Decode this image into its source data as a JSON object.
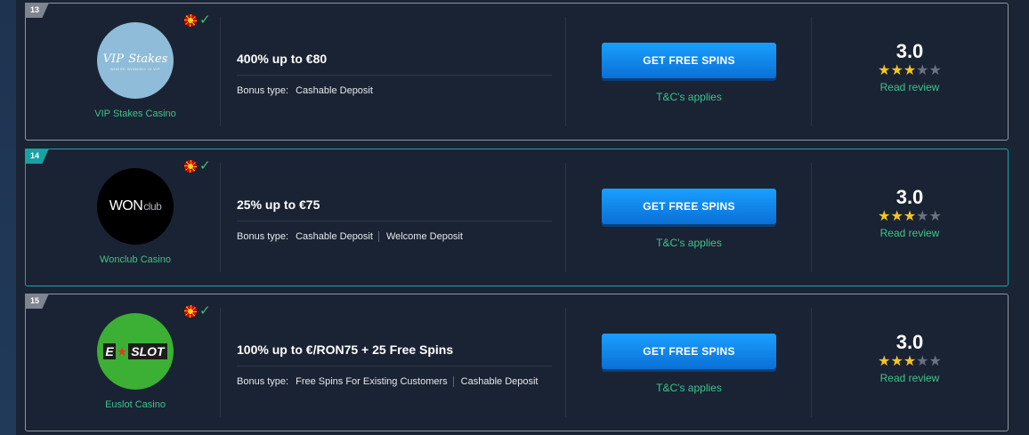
{
  "colors": {
    "accent_green": "#3ec38c",
    "button_blue": "#0a6fd6",
    "highlight_teal": "#1aa6a6",
    "star_yellow": "#f4c522"
  },
  "cards": [
    {
      "rank": "13",
      "casino_name": "VIP Stakes Casino",
      "logo": {
        "text_main": "VIP",
        "text_accent": "Stakes",
        "text_sub": "WHERE WINNING IS VIP"
      },
      "bonus_title": "400% up to €80",
      "bonus_type_label": "Bonus type:",
      "bonus_types": [
        "Cashable Deposit"
      ],
      "cta_label": "GET FREE SPINS",
      "tc_label": "T&C's applies",
      "score": "3.0",
      "stars_filled": 3,
      "read_review": "Read review",
      "icons": [
        "macedonia-flag-icon",
        "check-icon"
      ]
    },
    {
      "rank": "14",
      "casino_name": "Wonclub Casino",
      "logo": {
        "text_main": "WON",
        "text_accent": "club"
      },
      "bonus_title": "25% up to €75",
      "bonus_type_label": "Bonus type:",
      "bonus_types": [
        "Cashable Deposit",
        "Welcome Deposit"
      ],
      "cta_label": "GET FREE SPINS",
      "tc_label": "T&C's applies",
      "score": "3.0",
      "stars_filled": 3,
      "read_review": "Read review",
      "icons": [
        "macedonia-flag-icon",
        "check-icon"
      ]
    },
    {
      "rank": "15",
      "casino_name": "Euslot Casino",
      "logo": {
        "text_main": "E",
        "text_accent": "SLOT"
      },
      "bonus_title": "100% up to €/RON75 + 25 Free Spins",
      "bonus_type_label": "Bonus type:",
      "bonus_types": [
        "Free Spins For Existing Customers",
        "Cashable Deposit"
      ],
      "cta_label": "GET FREE SPINS",
      "tc_label": "T&C's applies",
      "score": "3.0",
      "stars_filled": 3,
      "read_review": "Read review",
      "icons": [
        "macedonia-flag-icon",
        "check-icon"
      ]
    }
  ]
}
